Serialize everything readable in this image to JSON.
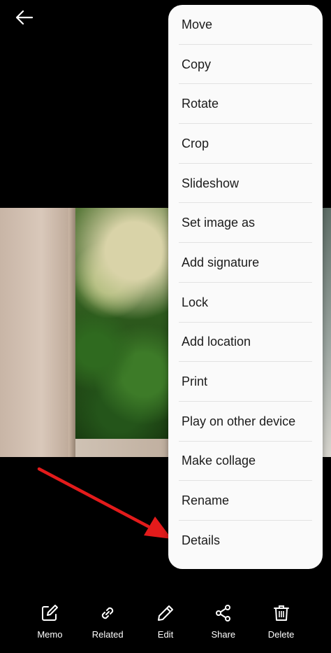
{
  "menu": {
    "items": [
      {
        "label": "Move"
      },
      {
        "label": "Copy"
      },
      {
        "label": "Rotate"
      },
      {
        "label": "Crop"
      },
      {
        "label": "Slideshow"
      },
      {
        "label": "Set image as"
      },
      {
        "label": "Add signature"
      },
      {
        "label": "Lock"
      },
      {
        "label": "Add location"
      },
      {
        "label": "Print"
      },
      {
        "label": "Play on other device"
      },
      {
        "label": "Make collage"
      },
      {
        "label": "Rename"
      },
      {
        "label": "Details"
      }
    ]
  },
  "toolbar": {
    "memo": "Memo",
    "related": "Related",
    "edit": "Edit",
    "share": "Share",
    "delete": "Delete"
  },
  "colors": {
    "background": "#000000",
    "menu_bg": "#fafafa",
    "annotation_arrow": "#e31b1b"
  }
}
